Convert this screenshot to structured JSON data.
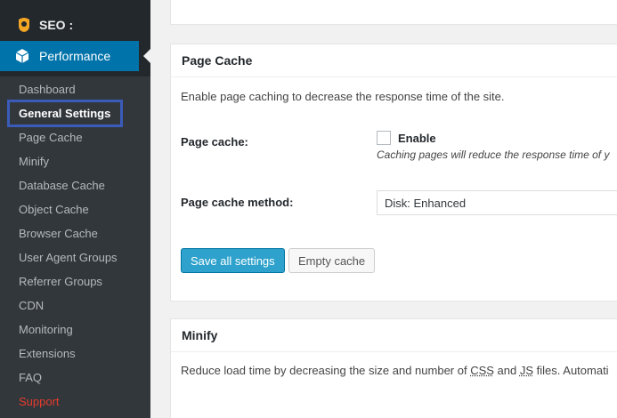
{
  "sidebar": {
    "seo": {
      "label": "SEO :",
      "icon": "seo-plugin-icon"
    },
    "performance": {
      "label": "Performance",
      "icon": "performance-cube-icon"
    },
    "submenu": [
      {
        "label": "Dashboard"
      },
      {
        "label": "General Settings",
        "active": true
      },
      {
        "label": "Page Cache"
      },
      {
        "label": "Minify"
      },
      {
        "label": "Database Cache"
      },
      {
        "label": "Object Cache"
      },
      {
        "label": "Browser Cache"
      },
      {
        "label": "User Agent Groups"
      },
      {
        "label": "Referrer Groups"
      },
      {
        "label": "CDN"
      },
      {
        "label": "Monitoring"
      },
      {
        "label": "Extensions"
      },
      {
        "label": "FAQ"
      },
      {
        "label": "Support"
      }
    ]
  },
  "page_cache": {
    "title": "Page Cache",
    "description": "Enable page caching to decrease the response time of the site.",
    "field_label": "Page cache:",
    "checkbox_label": "Enable",
    "checkbox_checked": false,
    "hint": "Caching pages will reduce the response time of y",
    "method_label": "Page cache method:",
    "method_value": "Disk: Enhanced",
    "save_button": "Save all settings",
    "empty_button": "Empty cache"
  },
  "minify": {
    "title": "Minify",
    "desc_before": "Reduce load time by decreasing the size and number of ",
    "abbr1": "CSS",
    "desc_mid": " and ",
    "abbr2": "JS",
    "desc_after": " files. Automati"
  },
  "colors": {
    "sidebar_bg": "#23282d",
    "submenu_bg": "#32373c",
    "accent": "#0073aa",
    "primary_button": "#2ea2cc",
    "support_red": "#e53b2c",
    "highlight_box": "#3a5bb8"
  }
}
